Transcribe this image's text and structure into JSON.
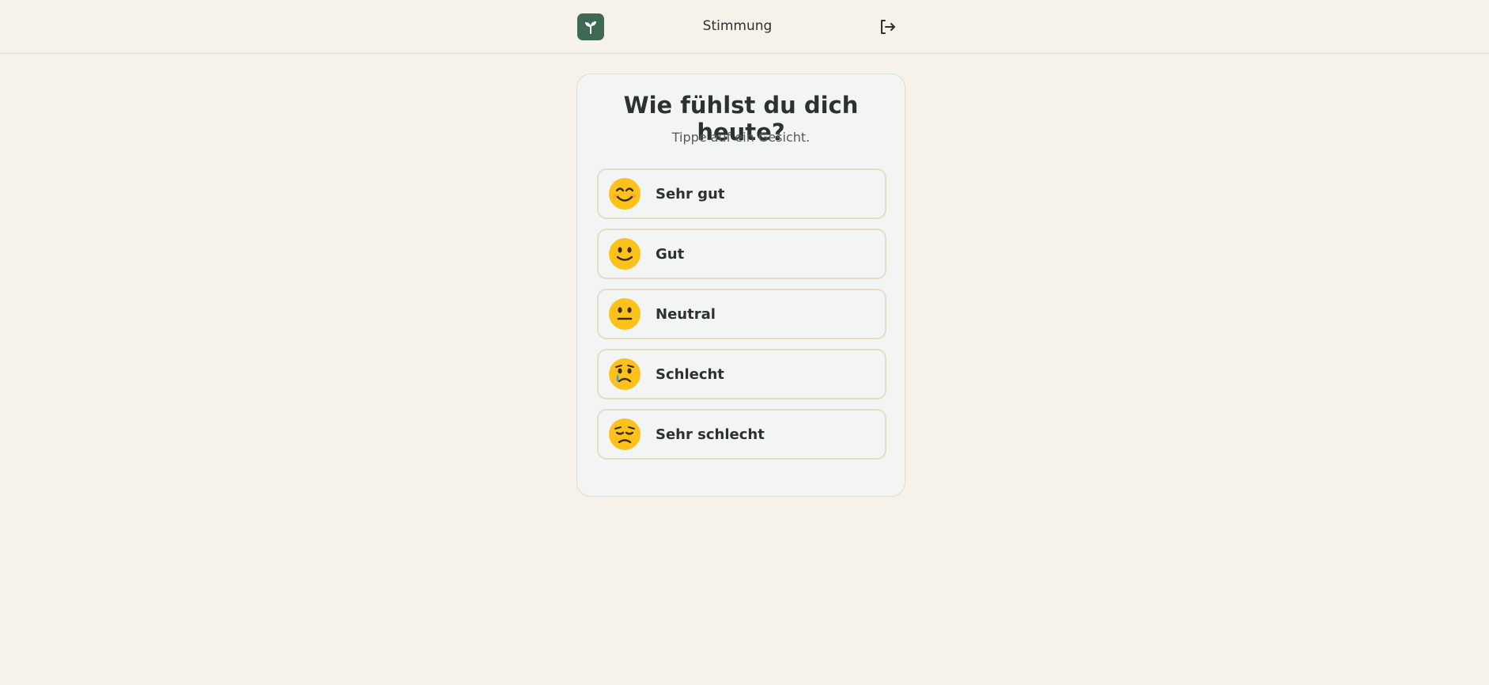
{
  "header": {
    "title": "Stimmung",
    "logo_icon": "sprout-icon",
    "logout_icon": "logout-icon"
  },
  "card": {
    "question": "Wie fühlst du dich heute?",
    "hint": "Tippe auf ein Gesicht."
  },
  "options": [
    {
      "label": "Sehr gut",
      "icon": "smiling-eyes-face-icon"
    },
    {
      "label": "Gut",
      "icon": "slight-smile-face-icon"
    },
    {
      "label": "Neutral",
      "icon": "neutral-face-icon"
    },
    {
      "label": "Schlecht",
      "icon": "crying-face-icon"
    },
    {
      "label": "Sehr schlecht",
      "icon": "disappointed-face-icon"
    }
  ],
  "colors": {
    "background": "#f6f1e9",
    "brand": "#3e6a55",
    "card": "#f2f5f3",
    "border": "#e6dcc6",
    "text": "#2b3230"
  }
}
